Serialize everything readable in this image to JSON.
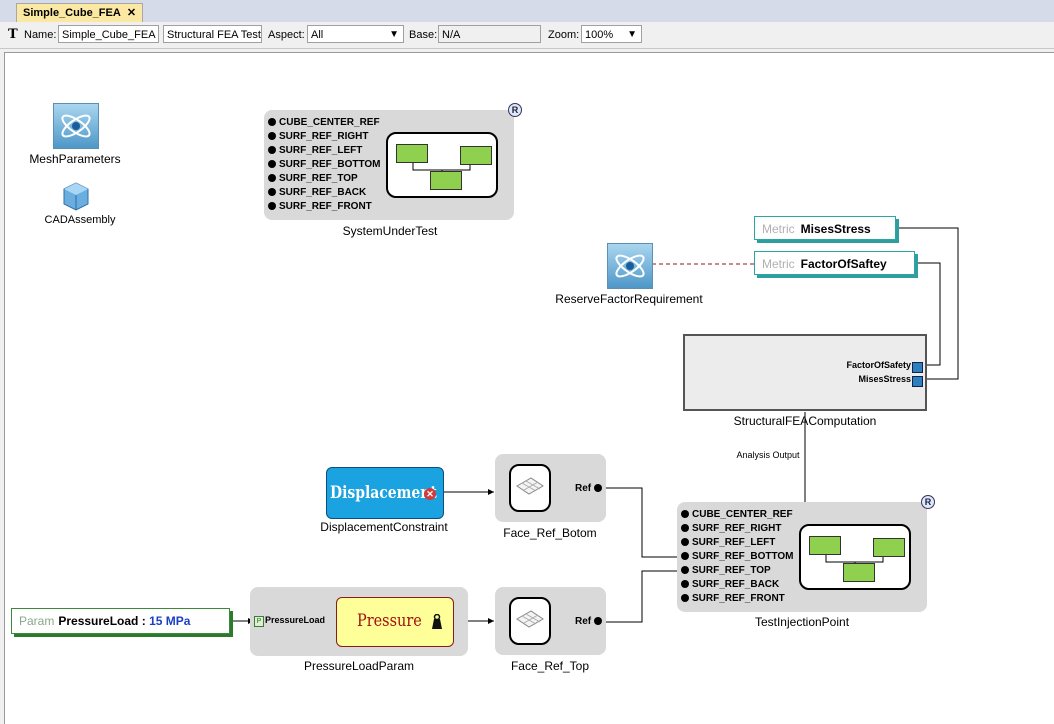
{
  "tab": {
    "title": "Simple_Cube_FEA",
    "close": "✕"
  },
  "toolbar": {
    "name_label": "Name:",
    "name_value": "Simple_Cube_FEA",
    "kind_value": "Structural FEA Test",
    "aspect_label": "Aspect:",
    "aspect_value": "All",
    "base_label": "Base:",
    "base_value": "N/A",
    "zoom_label": "Zoom:",
    "zoom_value": "100%"
  },
  "canvas": {
    "mesh_parameters": "MeshParameters",
    "cad_assembly": "CADAssembly",
    "system_under_test": {
      "label": "SystemUnderTest",
      "badge": "R",
      "ports": [
        "CUBE_CENTER_REF",
        "SURF_REF_RIGHT",
        "SURF_REF_LEFT",
        "SURF_REF_BOTTOM",
        "SURF_REF_TOP",
        "SURF_REF_BACK",
        "SURF_REF_FRONT"
      ]
    },
    "metric_mises": {
      "kind": "Metric",
      "name": "MisesStress"
    },
    "metric_fos": {
      "kind": "Metric",
      "name": "FactorOfSaftey"
    },
    "reserve_factor": "ReserveFactorRequirement",
    "structural": {
      "label": "StructuralFEAComputation",
      "ports": [
        "FactorOfSafety",
        "MisesStress"
      ],
      "analysis_output": "Analysis Output"
    },
    "displacement": {
      "text": "Displacement",
      "label": "DisplacementConstraint"
    },
    "face_bottom": {
      "label": "Face_Ref_Botom",
      "port": "Ref"
    },
    "face_top": {
      "label": "Face_Ref_Top",
      "port": "Ref"
    },
    "test_injection": {
      "label": "TestInjectionPoint",
      "badge": "R",
      "ports": [
        "CUBE_CENTER_REF",
        "SURF_REF_RIGHT",
        "SURF_REF_LEFT",
        "SURF_REF_BOTTOM",
        "SURF_REF_TOP",
        "SURF_REF_BACK",
        "SURF_REF_FRONT"
      ]
    },
    "pressure_param": {
      "kind": "Param",
      "name": "PressureLoad",
      "value": "15 MPa"
    },
    "pressure_block": {
      "label": "PressureLoadParam",
      "port_badge": "P",
      "port": "PressureLoad",
      "text": "Pressure"
    }
  },
  "colors": {
    "accent": "#2aa6a6",
    "metric_border": "#2aa6a6",
    "param_value": "#1a3fc4",
    "displacement_bg": "#1aa3e0",
    "pressure_bg": "#ffff99",
    "green_box": "#8fd14f"
  }
}
